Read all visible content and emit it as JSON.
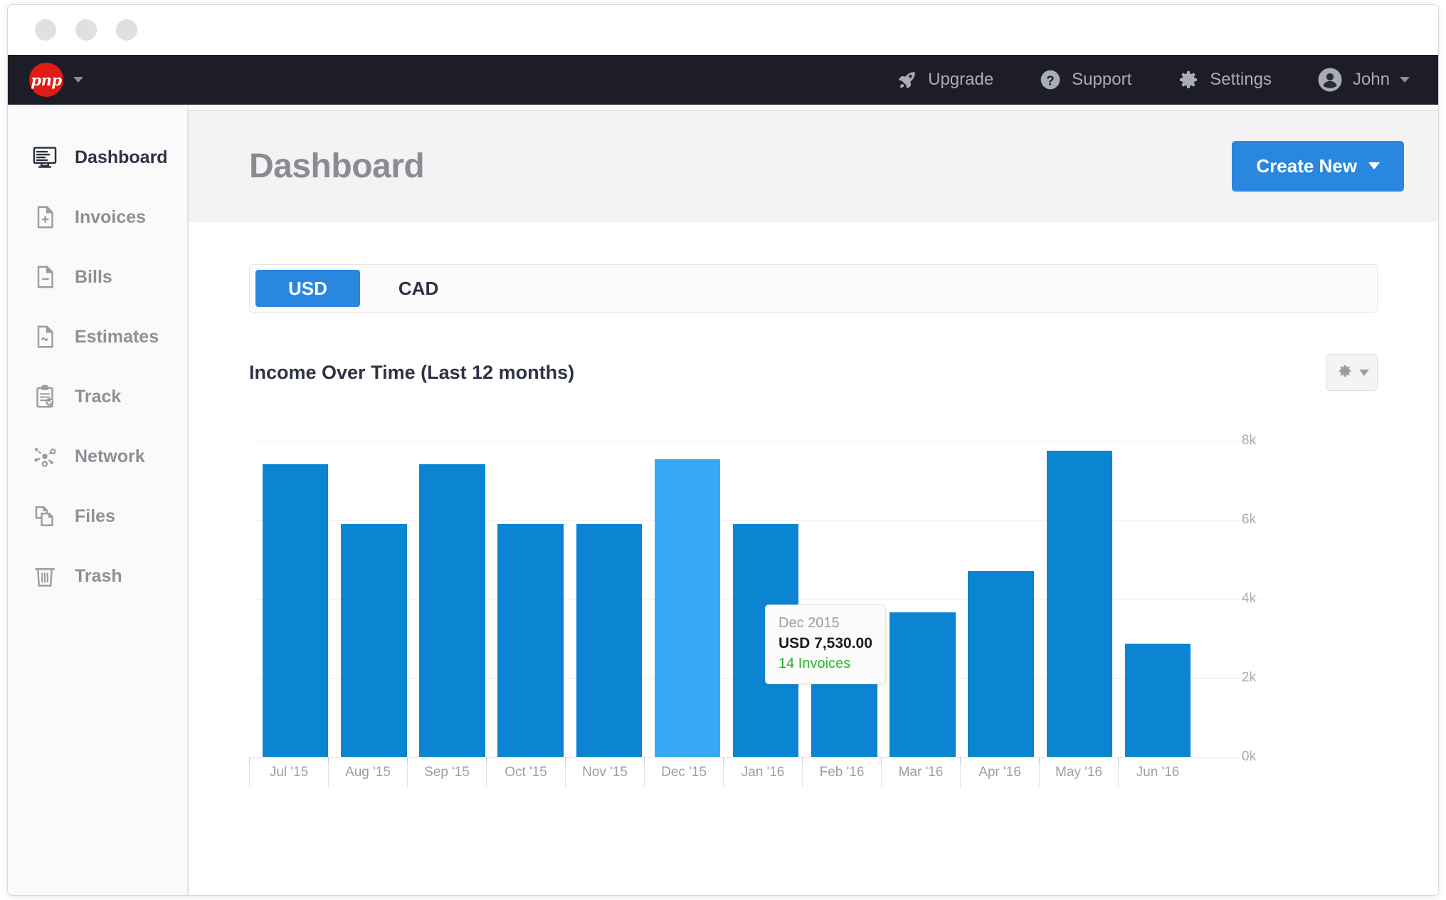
{
  "window": {
    "traffic_lights": [
      "close",
      "minimize",
      "maximize"
    ]
  },
  "topnav": {
    "brand_logo_text": "pnp",
    "brand_caret_icon": "chevron-down-icon",
    "items": [
      {
        "label": "Upgrade",
        "icon": "rocket-icon"
      },
      {
        "label": "Support",
        "icon": "question-circle-icon"
      },
      {
        "label": "Settings",
        "icon": "gear-icon"
      },
      {
        "label": "John",
        "icon": "user-avatar-icon",
        "caret": "chevron-down-icon"
      }
    ]
  },
  "sidebar": {
    "items": [
      {
        "label": "Dashboard",
        "icon": "monitor-icon",
        "active": true
      },
      {
        "label": "Invoices",
        "icon": "document-plus-icon",
        "active": false
      },
      {
        "label": "Bills",
        "icon": "document-minus-icon",
        "active": false
      },
      {
        "label": "Estimates",
        "icon": "document-wave-icon",
        "active": false
      },
      {
        "label": "Track",
        "icon": "clipboard-check-icon",
        "active": false
      },
      {
        "label": "Network",
        "icon": "network-nodes-icon",
        "active": false
      },
      {
        "label": "Files",
        "icon": "files-stack-icon",
        "active": false
      },
      {
        "label": "Trash",
        "icon": "trash-can-icon",
        "active": false
      }
    ]
  },
  "page": {
    "title": "Dashboard",
    "create_button_label": "Create New",
    "create_button_caret": "chevron-down-icon"
  },
  "currency_tabs": {
    "options": [
      "USD",
      "CAD"
    ],
    "selected": "USD"
  },
  "chart_panel": {
    "title": "Income Over Time (Last 12 months)",
    "options_button_icon": "gear-icon",
    "options_button_caret": "caret-down-icon"
  },
  "tooltip": {
    "date": "Dec 2015",
    "amount": "USD 7,530.00",
    "invoices": "14 Invoices"
  },
  "colors": {
    "accent_blue": "#2a87df",
    "bar_blue": "#0b84d1",
    "bar_highlight_blue": "#35a9f4",
    "nav_dark": "#1c1d26",
    "brand_red": "#e01b15",
    "tooltip_green": "#2bb431"
  },
  "chart_data": {
    "type": "bar",
    "title": "Income Over Time (Last 12 months)",
    "xlabel": "",
    "ylabel": "",
    "ylim": [
      0,
      8000
    ],
    "grid": true,
    "legend": null,
    "currency": "USD",
    "ytick_labels": [
      "0k",
      "2k",
      "4k",
      "6k",
      "8k"
    ],
    "ytick_values": [
      0,
      2000,
      4000,
      6000,
      8000
    ],
    "categories": [
      "Jul '15",
      "Aug '15",
      "Sep '15",
      "Oct '15",
      "Nov '15",
      "Dec '15",
      "Jan '16",
      "Feb '16",
      "Mar '16",
      "Apr '16",
      "May '16",
      "Jun '16"
    ],
    "values": [
      7400,
      5900,
      7400,
      5900,
      5900,
      7530,
      5900,
      2950,
      3650,
      4700,
      7750,
      2860
    ],
    "highlighted_index": 5,
    "highlighted_label": "Dec '15",
    "highlighted_value": 7530,
    "highlighted_invoices": 14
  }
}
